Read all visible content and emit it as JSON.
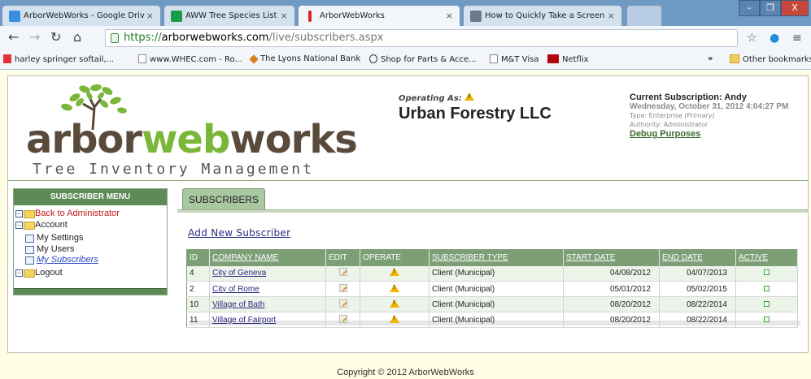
{
  "browser": {
    "tabs": [
      {
        "label": "ArborWebWorks - Google Driv",
        "icon": "google-drive-icon",
        "color": "#3b8fe0"
      },
      {
        "label": "AWW Tree Species List",
        "icon": "sheets-icon",
        "color": "#1a9c4b"
      },
      {
        "label": "ArborWebWorks",
        "icon": "site-icon",
        "color": "#d7262b"
      },
      {
        "label": "How to Quickly Take a Screen",
        "icon": "article-icon",
        "color": "#6a7b8c"
      }
    ],
    "close_glyph": "×",
    "window": {
      "minimize": "–",
      "restore": "❐",
      "close": "X"
    },
    "url": {
      "scheme": "https://",
      "host": "arborwebworks.com",
      "path": "/live/subscribers.aspx"
    },
    "bookmarks": [
      "harley springer softail,...",
      "www.WHEC.com - Ro...",
      "The Lyons National Bank",
      "Shop for Parts & Acce...",
      "M&T Visa",
      "Netflix"
    ],
    "bookmarks_overflow": "»",
    "other_bookmarks": "Other bookmarks"
  },
  "brand": {
    "word_dark": "arbor",
    "word_green": "web",
    "word_dark2": "works",
    "tagline": "Tree Inventory Management"
  },
  "operating": {
    "label": "Operating As:",
    "org": "Urban Forestry LLC"
  },
  "subscription": {
    "title": "Current Subscription: Andy",
    "date": "Wednesday, October 31, 2012 4:04:27 PM",
    "type_label": "Type: Enterprise",
    "type_primary": "(Primary)",
    "authority": "Authority: Administrator",
    "debug": "Debug Purposes"
  },
  "sidebar": {
    "title": "SUBSCRIBER MENU",
    "items": [
      {
        "label": "Back to Administrator",
        "kind": "folder",
        "style": "red"
      },
      {
        "label": "Account",
        "kind": "folder",
        "style": "plain"
      },
      {
        "label": "My Settings",
        "kind": "page",
        "style": "plain"
      },
      {
        "label": "My Users",
        "kind": "page",
        "style": "plain"
      },
      {
        "label": "My Subscribers",
        "kind": "page",
        "style": "blue"
      },
      {
        "label": "Logout",
        "kind": "folder",
        "style": "plain"
      }
    ]
  },
  "main": {
    "tab_label": "SUBSCRIBERS",
    "add_link": "Add New Subscriber",
    "columns": [
      "ID",
      "COMPANY NAME",
      "EDIT",
      "OPERATE",
      "SUBSCRIBER TYPE",
      "START DATE",
      "END DATE",
      "ACTIVE"
    ],
    "rows": [
      {
        "id": "4",
        "company": "City of Geneva",
        "type": "Client (Municipal)",
        "start": "04/08/2012",
        "end": "04/07/2013"
      },
      {
        "id": "2",
        "company": "City of Rome",
        "type": "Client (Municipal)",
        "start": "05/01/2012",
        "end": "05/02/2015"
      },
      {
        "id": "10",
        "company": "Village of Bath",
        "type": "Client (Municipal)",
        "start": "08/20/2012",
        "end": "08/22/2014"
      },
      {
        "id": "11",
        "company": "Village of Fairport",
        "type": "Client (Municipal)",
        "start": "08/20/2012",
        "end": "08/22/2014"
      }
    ]
  },
  "footer": "Copyright © 2012 ArborWebWorks",
  "colors": {
    "accent_green": "#7c9f76",
    "page_bg": "#fffde4",
    "brand_green": "#7ab637",
    "brand_brown": "#5a4a3c"
  }
}
